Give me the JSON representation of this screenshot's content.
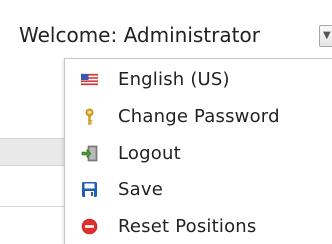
{
  "header": {
    "welcome_text": "Welcome: Administrator"
  },
  "user_menu": {
    "items": [
      {
        "label": "English (US)",
        "icon": "us-flag-icon"
      },
      {
        "label": "Change Password",
        "icon": "key-icon"
      },
      {
        "label": "Logout",
        "icon": "logout-door-icon"
      },
      {
        "label": "Save",
        "icon": "floppy-disk-icon"
      },
      {
        "label": "Reset Positions",
        "icon": "red-circle-minus-icon"
      }
    ]
  },
  "colors": {
    "save_icon_blue": "#1f5fb5",
    "reset_icon_red": "#e0302c",
    "key_icon_gold": "#d9a520",
    "logout_icon_green": "#4a9a2e"
  }
}
